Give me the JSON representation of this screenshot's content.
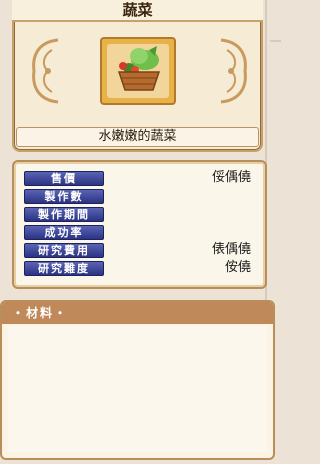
{
  "item": {
    "title": "蔬菜",
    "description": "水嫩嫩的蔬菜"
  },
  "stats": [
    {
      "label": "售價",
      "value": "俀偊僥"
    },
    {
      "label": "製作數",
      "value": ""
    },
    {
      "label": "製作期間",
      "value": ""
    },
    {
      "label": "成功率",
      "value": ""
    },
    {
      "label": "研究費用",
      "value": "俵偊僥"
    },
    {
      "label": "研究難度",
      "value": "侒僥"
    }
  ],
  "materials": {
    "title": "・材料・"
  },
  "colors": {
    "label_bg": "#2b3382",
    "frame_gold": "#e7b247",
    "panel_border": "#b98e58",
    "header_brown": "#c0895a"
  }
}
